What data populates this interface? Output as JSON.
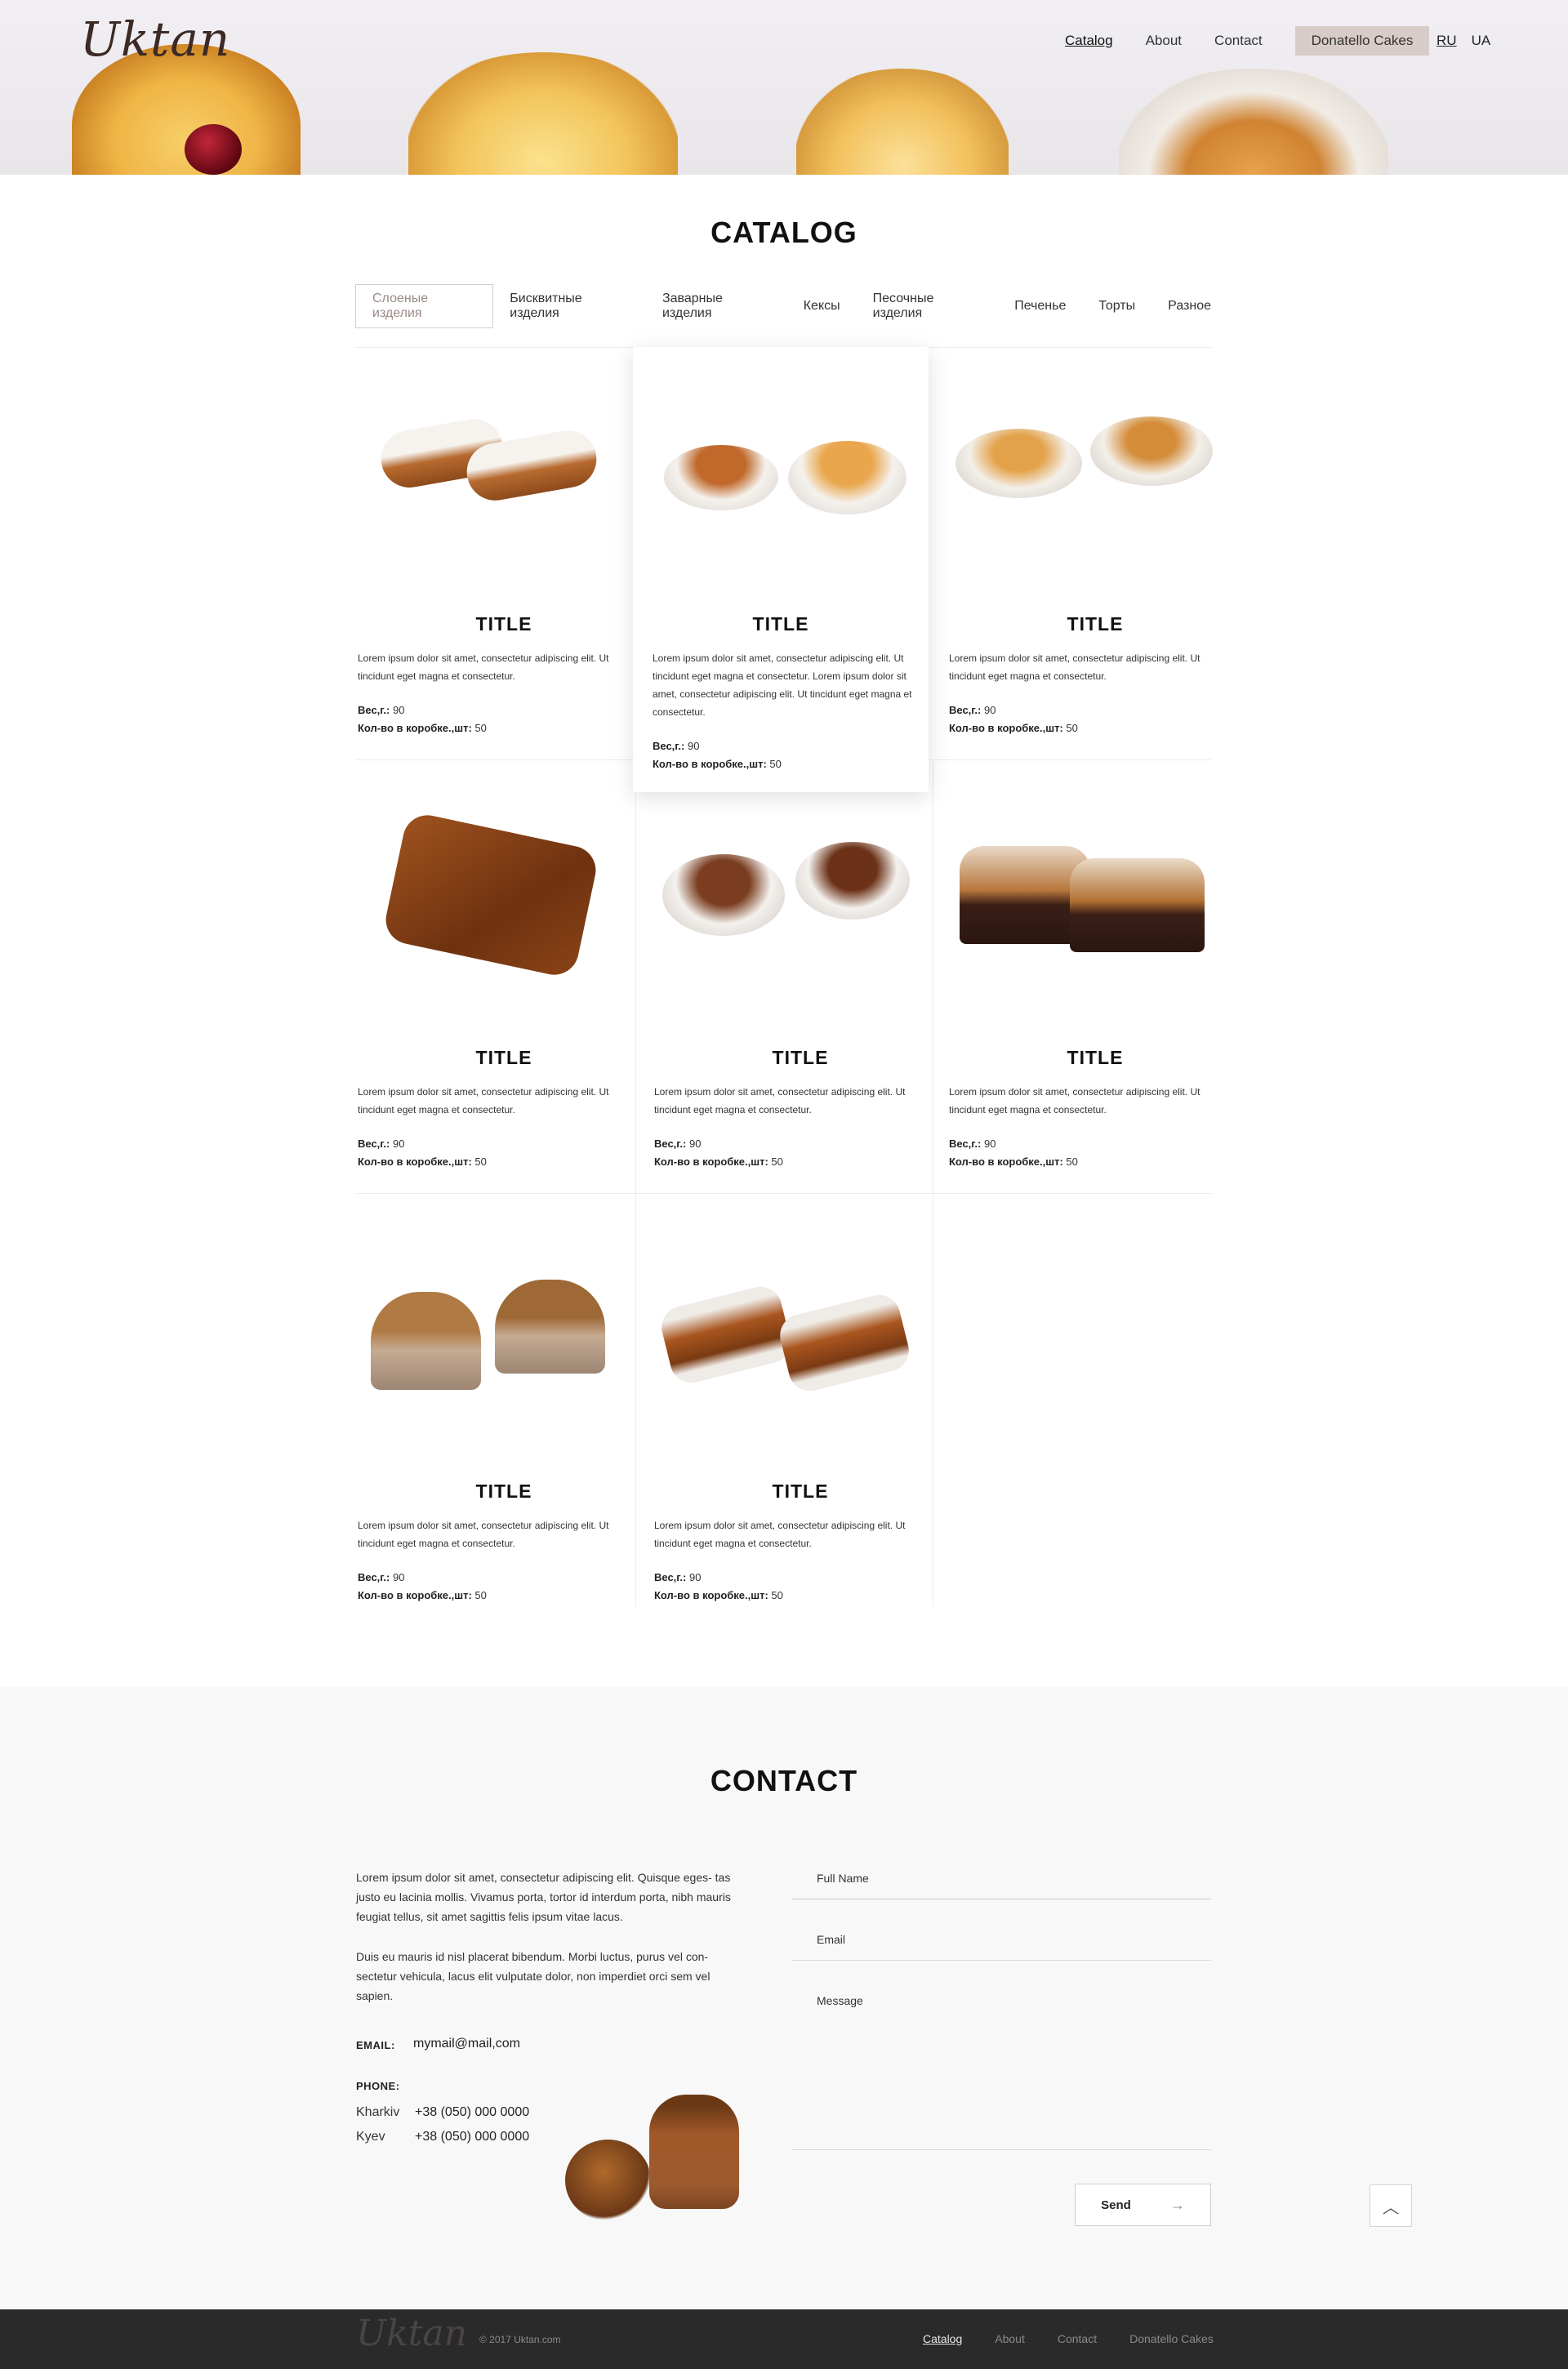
{
  "header": {
    "logo": "Uktan",
    "nav": [
      "Catalog",
      "About",
      "Contact"
    ],
    "nav_pill": "Donatello Cakes",
    "lang": [
      "RU",
      "UA"
    ]
  },
  "catalog": {
    "title": "CATALOG",
    "tabs": [
      "Слоеные изделия",
      "Бисквитные изделия",
      "Заварные изделия",
      "Кексы",
      "Песочные изделия",
      "Печенье",
      "Торты",
      "Разное"
    ],
    "weight_label": "Вес,г.:",
    "box_label": "Кол-во в коробке.,шт:",
    "products": [
      {
        "title": "TITLE",
        "desc": "Lorem ipsum dolor sit amet, consectetur adipiscing elit. Ut tincidunt eget magna et consectetur.",
        "weight": "90",
        "box": "50"
      },
      {
        "title": "TITLE",
        "desc": "Lorem ipsum dolor sit amet, consectetur adipiscing elit. Ut tincidunt eget magna et consectetur. Lorem ipsum dolor sit amet, consectetur adipiscing elit. Ut tincidunt eget magna et consectetur.",
        "weight": "90",
        "box": "50"
      },
      {
        "title": "TITLE",
        "desc": "Lorem ipsum dolor sit amet, consectetur adipiscing elit. Ut tincidunt eget magna et consectetur.",
        "weight": "90",
        "box": "50"
      },
      {
        "title": "TITLE",
        "desc": "Lorem ipsum dolor sit amet, consectetur adipiscing elit. Ut tincidunt eget magna et consectetur.",
        "weight": "90",
        "box": "50"
      },
      {
        "title": "TITLE",
        "desc": "Lorem ipsum dolor sit amet, consectetur adipiscing elit. Ut tincidunt eget magna et consectetur.",
        "weight": "90",
        "box": "50"
      },
      {
        "title": "TITLE",
        "desc": "Lorem ipsum dolor sit amet, consectetur adipiscing elit. Ut tincidunt eget magna et consectetur.",
        "weight": "90",
        "box": "50"
      },
      {
        "title": "TITLE",
        "desc": "Lorem ipsum dolor sit amet, consectetur adipiscing elit. Ut tincidunt eget magna et consectetur.",
        "weight": "90",
        "box": "50"
      },
      {
        "title": "TITLE",
        "desc": "Lorem ipsum dolor sit amet, consectetur adipiscing elit. Ut tincidunt eget magna et consectetur.",
        "weight": "90",
        "box": "50"
      }
    ]
  },
  "contact": {
    "title": "CONTACT",
    "paragraph1": "Lorem ipsum dolor sit amet, consectetur adipiscing elit. Quisque eges- tas justo eu lacinia mollis. Vivamus porta, tortor id interdum porta, nibh mauris feugiat tellus, sit amet sagittis felis ipsum vitae lacus.",
    "paragraph2": "Duis eu mauris id nisl placerat bibendum. Morbi luctus, purus vel con- sectetur vehicula, lacus elit vulputate dolor, non imperdiet orci sem vel sapien.",
    "email_label": "EMAIL:",
    "email": "mymail@mail,com",
    "phone_label": "PHONE:",
    "phones": [
      {
        "city": "Kharkiv",
        "number": "+38 (050) 000 0000"
      },
      {
        "city": "Kyev",
        "number": "+38 (050) 000 0000"
      }
    ],
    "form": {
      "name_placeholder": "Full Name",
      "email_placeholder": "Email",
      "message_placeholder": "Message",
      "send": "Send"
    }
  },
  "footer": {
    "logo": "Uktan",
    "copyright": "© 2017 Uktan.com",
    "nav": [
      "Catalog",
      "About",
      "Contact",
      "Donatello Cakes"
    ]
  }
}
